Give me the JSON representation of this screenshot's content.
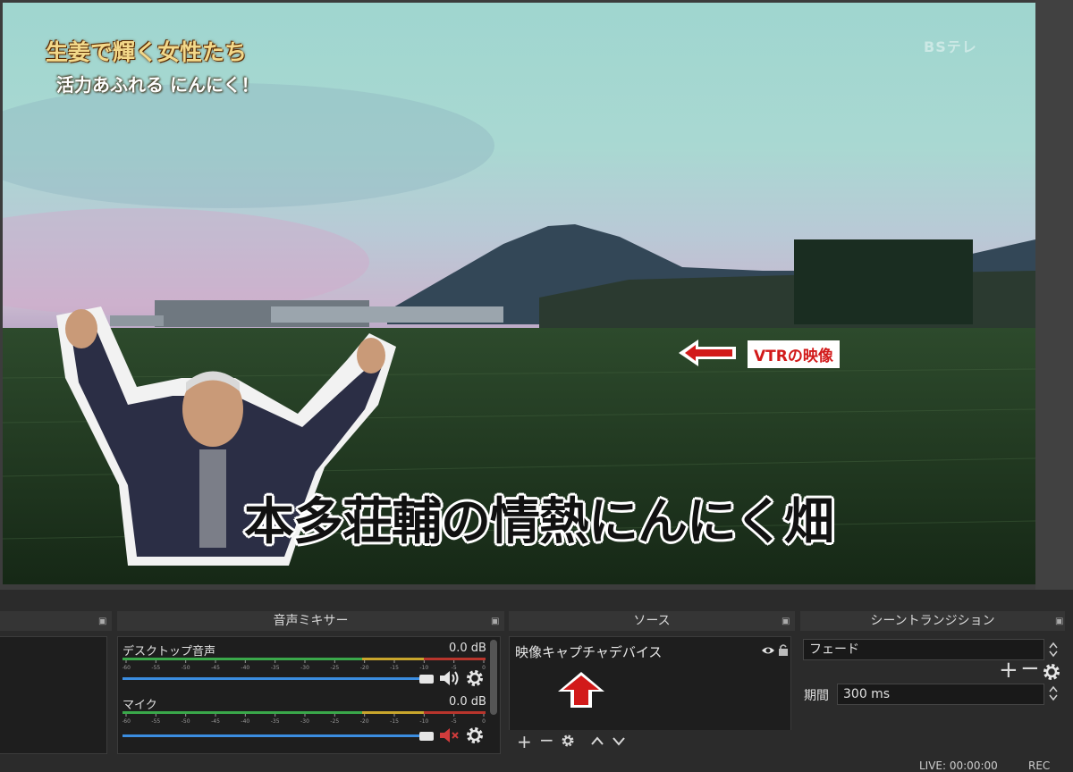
{
  "video": {
    "program_title": "生姜で輝く女性たち",
    "program_subtitle": "活力あふれる にんにく！",
    "channel_logo": "BSテレ",
    "caption": "本多荘輔の情熱にんにく畑",
    "annotation_label": "VTRの映像"
  },
  "docks": {
    "mixer": {
      "title": "音声ミキサー",
      "channels": [
        {
          "name": "デスクトップ音声",
          "level": "0.0 dB",
          "muted": false
        },
        {
          "name": "マイク",
          "level": "0.0 dB",
          "muted": true
        }
      ],
      "scale": [
        "-60",
        "-55",
        "-50",
        "-45",
        "-40",
        "-35",
        "-30",
        "-25",
        "-20",
        "-15",
        "-10",
        "-5",
        "0"
      ]
    },
    "sources": {
      "title": "ソース",
      "items": [
        "映像キャプチャデバイス"
      ]
    },
    "transitions": {
      "title": "シーントランジション",
      "selected": "フェード",
      "duration_label": "期間",
      "duration_value": "300 ms"
    }
  },
  "statusbar": {
    "live": "LIVE: 00:00:00",
    "rec": "REC"
  },
  "colors": {
    "accent_blue": "#3b8de0",
    "callout_red": "#d21a1a",
    "meter_green": "#3aa84a",
    "meter_yellow": "#c9a62c",
    "meter_red": "#b8352c"
  }
}
